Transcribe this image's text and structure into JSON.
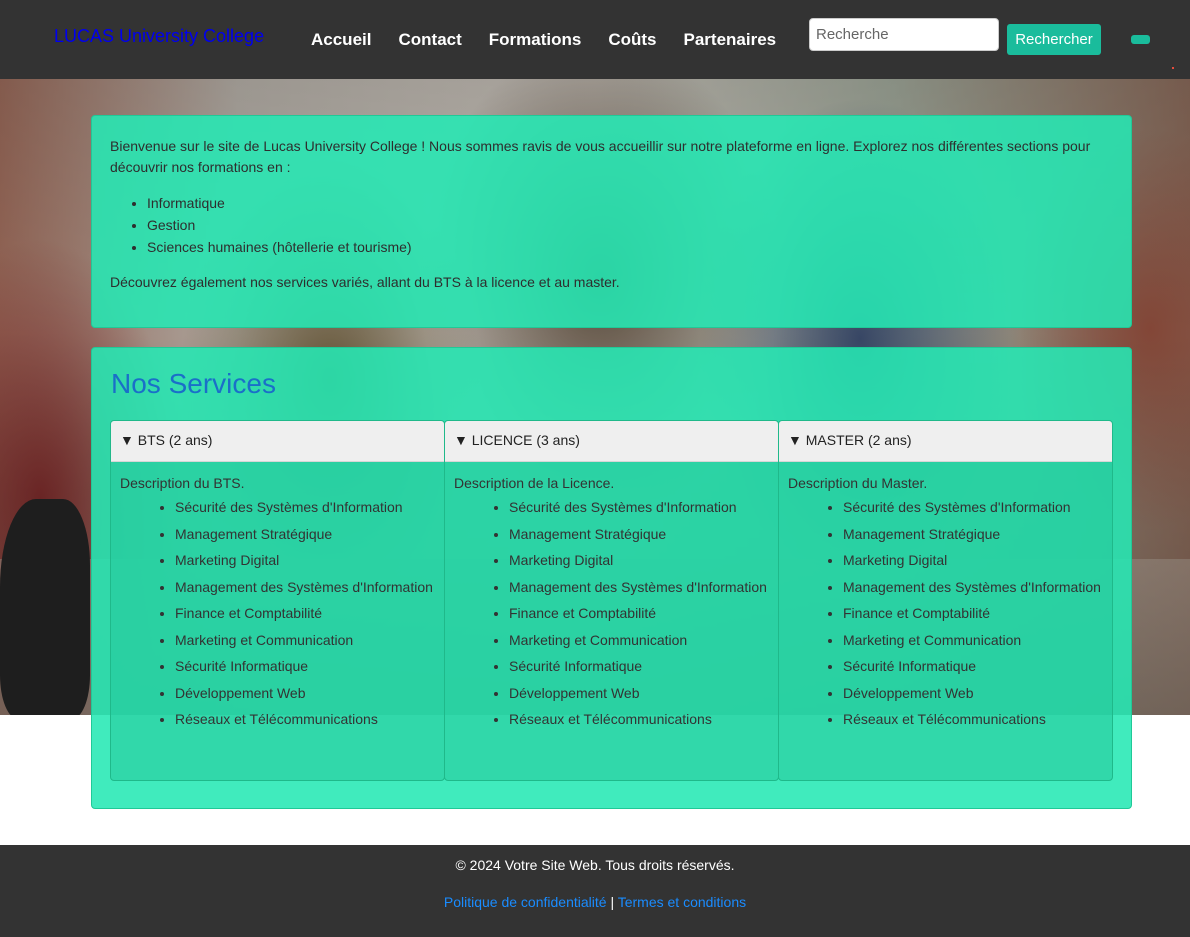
{
  "header": {
    "logo": "LUCAS University College",
    "nav": [
      "Accueil",
      "Contact",
      "Formations",
      "Coûts",
      "Partenaires"
    ],
    "search_placeholder": "Recherche",
    "search_button": "Rechercher",
    "colors": {
      "background": "#333333",
      "accent": "#1abc9c",
      "logo": "#0000ee"
    },
    "menu_icon": "menu-toggle-icon"
  },
  "welcome": {
    "intro": "Bienvenue sur le site de Lucas University College ! Nous sommes ravis de vous accueillir sur notre plateforme en ligne. Explorez nos différentes sections pour découvrir nos formations en :",
    "domains": [
      "Informatique",
      "Gestion",
      "Sciences humaines (hôtellerie et tourisme)"
    ],
    "outro": "Découvrez également nos services variés, allant du BTS à la licence et au master."
  },
  "services": {
    "title": "Nos Services",
    "columns": [
      {
        "header": "▼ BTS (2 ans)",
        "description": "Description du BTS.",
        "items": [
          "Sécurité des Systèmes d'Information",
          "Management Stratégique",
          "Marketing Digital",
          "Management des Systèmes d'Information",
          "Finance et Comptabilité",
          "Marketing et Communication",
          "Sécurité Informatique",
          "Développement Web",
          "Réseaux et Télécommunications"
        ]
      },
      {
        "header": "▼ LICENCE (3 ans)",
        "description": "Description de la Licence.",
        "items": [
          "Sécurité des Systèmes d'Information",
          "Management Stratégique",
          "Marketing Digital",
          "Management des Systèmes d'Information",
          "Finance et Comptabilité",
          "Marketing et Communication",
          "Sécurité Informatique",
          "Développement Web",
          "Réseaux et Télécommunications"
        ]
      },
      {
        "header": "▼ MASTER (2 ans)",
        "description": "Description du Master.",
        "items": [
          "Sécurité des Systèmes d'Information",
          "Management Stratégique",
          "Marketing Digital",
          "Management des Systèmes d'Information",
          "Finance et Comptabilité",
          "Marketing et Communication",
          "Sécurité Informatique",
          "Développement Web",
          "Réseaux et Télécommunications"
        ]
      }
    ],
    "colors": {
      "panel": "#26e8b4",
      "title": "#1a6fc9"
    }
  },
  "footer": {
    "copyright": "© 2024 Votre Site Web. Tous droits réservés.",
    "privacy": "Politique de confidentialité",
    "separator": "|",
    "terms": "Termes et conditions",
    "colors": {
      "background": "#333333",
      "link": "#1a8cff"
    }
  }
}
